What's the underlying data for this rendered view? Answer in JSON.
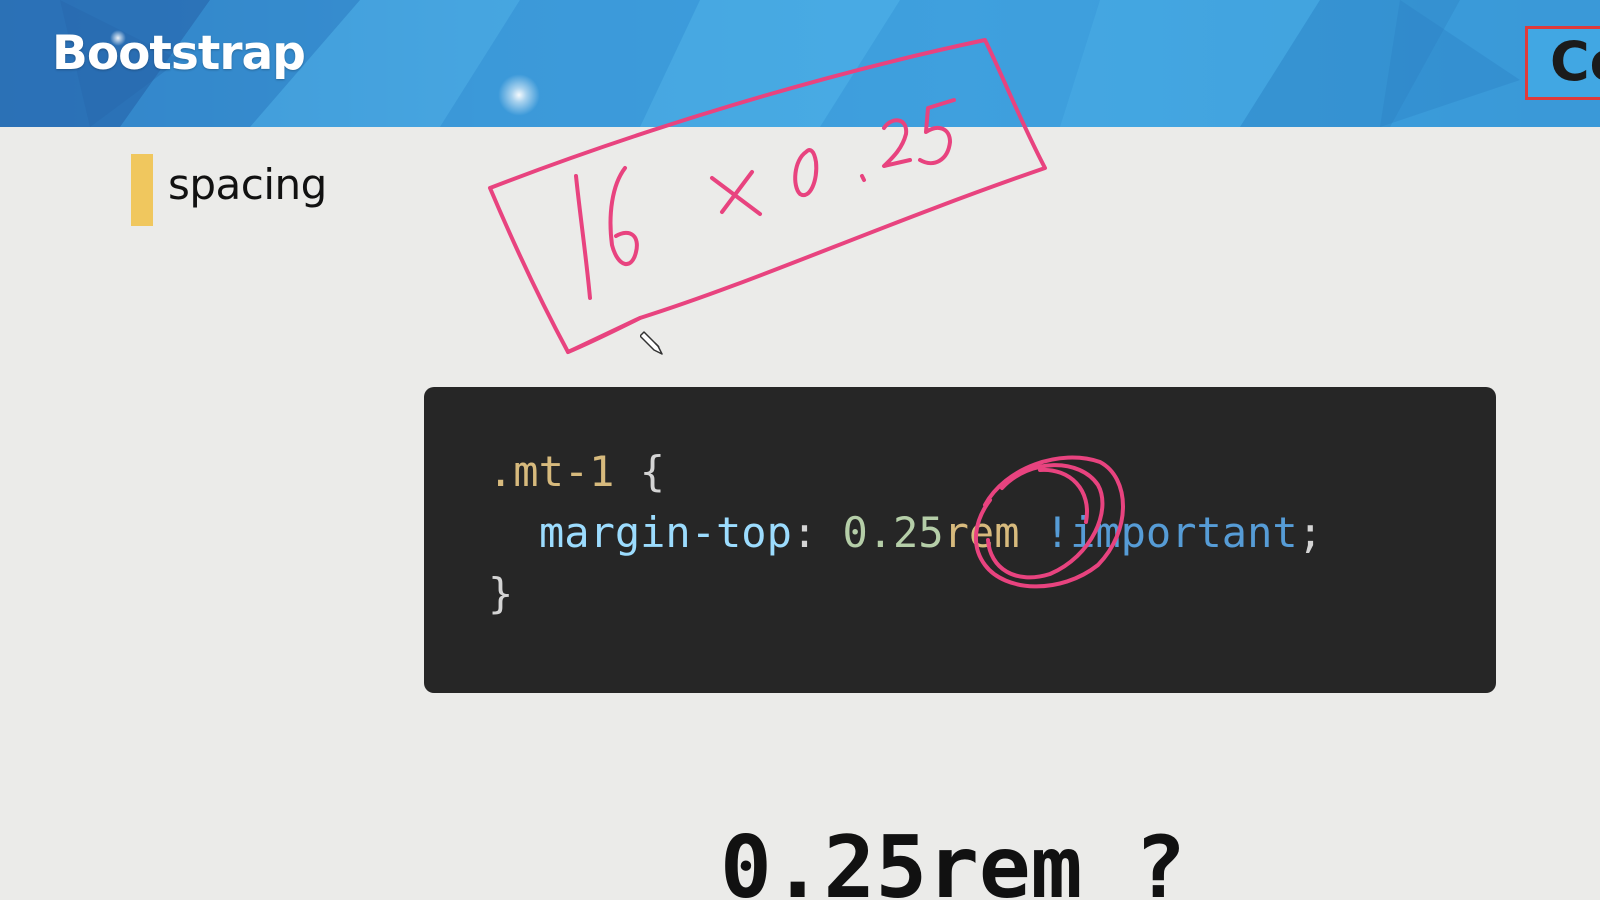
{
  "header": {
    "title": "Bootstrap",
    "corner_button_label": "Co",
    "colors": {
      "banner_blue": "#3d9bd9",
      "corner_border": "#e03a3a"
    }
  },
  "section": {
    "label": "spacing",
    "marker_color": "#f0c75e"
  },
  "code": {
    "line1": {
      "selector": ".mt-1",
      "brace": "{"
    },
    "line2": {
      "property": "margin-top",
      "colon": ":",
      "number": "0.25",
      "unit": "rem",
      "important": "!important",
      "semicolon": ";"
    },
    "line3": {
      "brace": "}"
    },
    "background": "#262626"
  },
  "annotation": {
    "handwritten_text": "16 × 0.25",
    "pen_color": "#e8437f",
    "tool_icon": "pen-icon"
  },
  "question": {
    "text": "0.25rem ?"
  }
}
